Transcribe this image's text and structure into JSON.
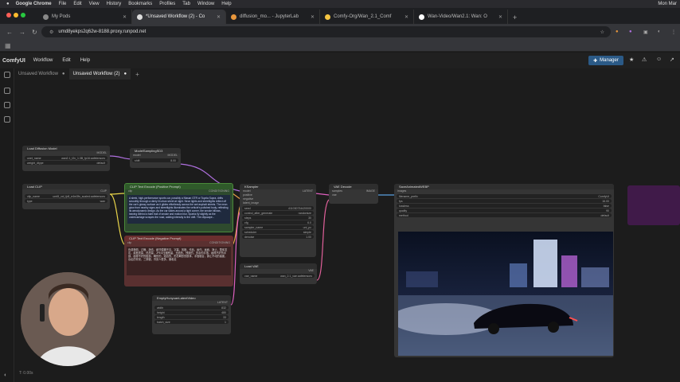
{
  "macbar": {
    "app": "Google Chrome",
    "menus": [
      "File",
      "Edit",
      "View",
      "History",
      "Bookmarks",
      "Profiles",
      "Tab",
      "Window",
      "Help"
    ],
    "clock": "Mon Mar"
  },
  "browser_tabs": [
    {
      "label": "My Pods",
      "active": false
    },
    {
      "label": "*Unsaved Workflow (2) - Co",
      "active": true
    },
    {
      "label": "diffusion_mo... - JupyterLab",
      "active": false
    },
    {
      "label": "Comfy-Org/Wan_2.1_Comf",
      "active": false
    },
    {
      "label": "Wan-Video/Wan2.1: Wan: O",
      "active": false
    }
  ],
  "url": "umd8yekps2q62w-8188.proxy.runpod.net",
  "comfy_menu": {
    "logo": "ComfyUI",
    "items": [
      "Workflow",
      "Edit",
      "Help"
    ],
    "manager": "Manager"
  },
  "workflow_tabs": [
    {
      "label": "Unsaved Workflow"
    },
    {
      "label": "Unsaved Workflow (2)"
    }
  ],
  "nodes": {
    "load_diffusion": {
      "title": "Load Diffusion Model",
      "out": "MODEL",
      "unet_name": "unet_name",
      "unet_value": "wan2.1_t2v_1.3B_fp16.safetensors",
      "weight_label": "weight_dtype",
      "weight_value": "default"
    },
    "model_sampling": {
      "title": "ModelSamplingSD3",
      "in": "model",
      "out": "MODEL",
      "shift_label": "shift",
      "shift_value": "8.00"
    },
    "load_clip": {
      "title": "Load CLIP",
      "out": "CLIP",
      "clip_label": "clip_name",
      "clip_value": "umt5_xxl_fp8_e4m3fn_scaled.safetensors",
      "type_label": "type",
      "type_value": "wan"
    },
    "clip_pos": {
      "title": "CLIP Text Encode (Positive Prompt)",
      "in": "clip",
      "out": "CONDITIONING",
      "text": "A sleek, high-performance sports car, possibly a Nissan GTR or Toyota Supra, drifts smoothly through a dimly lit urban street at night. Neon lights and streetlights reflect off the car's glossy surface as it glides effortlessly across the wet asphalt streets. The neon glow from nearby signs and streetlights illuminates the vehicle's polished body, reflecting its aerodynamic design. As the car slides around a tight corner, tire smoke billows, leaving behind a faint trail of smoke and motion blur. Sparks fly slightly as the undercarriage scrapes the road, adding intensity to the drift. The cityscape..."
    },
    "clip_neg": {
      "title": "CLIP Text Encode (Negative Prompt)",
      "in": "clip",
      "out": "CONDITIONING",
      "text": "色调艳丽，过曝，静态，细节模糊不清，字幕，风格，作品，画作，画面，静止，整体发灰，最差质量，低质量，JPEG压缩残留，丑陋的，残缺的，多余的手指，画得不好的手部，画得不好的脸部，畸形的，毁容的，形态畸形的肢体，手指融合，静止不动的画面，杂乱的背景，三条腿，背景人很多，倒着走"
    },
    "ksampler": {
      "title": "KSampler",
      "out": "LATENT",
      "ports": [
        "model",
        "positive",
        "negative",
        "latent_image"
      ],
      "widgets": [
        [
          "seed",
          "411030734420000"
        ],
        [
          "control_after_generate",
          "randomize"
        ],
        [
          "steps",
          "30"
        ],
        [
          "cfg",
          "6.0"
        ],
        [
          "sampler_name",
          "uni_pc"
        ],
        [
          "scheduler",
          "simple"
        ],
        [
          "denoise",
          "1.00"
        ]
      ]
    },
    "vae_decode": {
      "title": "VAE Decode",
      "in1": "samples",
      "in2": "vae",
      "out": "IMAGE"
    },
    "load_vae": {
      "title": "Load VAE",
      "out": "VAE",
      "vae_label": "vae_name",
      "vae_value": "wan_2.1_vae.safetensors"
    },
    "latent": {
      "title": "EmptyHunyuanLatentVideo",
      "out": "LATENT",
      "widgets": [
        [
          "width",
          "832"
        ],
        [
          "height",
          "480"
        ],
        [
          "length",
          "33"
        ],
        [
          "batch_size",
          "1"
        ]
      ]
    },
    "save_webp": {
      "title": "SaveAnimatedWEBP",
      "in": "images",
      "widgets": [
        [
          "filename_prefix",
          "ComfyUI"
        ],
        [
          "fps",
          "16.00"
        ],
        [
          "lossless",
          "false"
        ],
        [
          "quality",
          "90"
        ],
        [
          "method",
          "default"
        ]
      ]
    }
  },
  "zoom_readout": "T: 0.00s",
  "colors": {
    "accent": "#2b5a87",
    "pos_node": "#2f5a2a",
    "neg_node": "#6a2e2e",
    "wire_pink": "#e0609a",
    "wire_yellow": "#e8d44a",
    "wire_purple": "#b070e0"
  }
}
